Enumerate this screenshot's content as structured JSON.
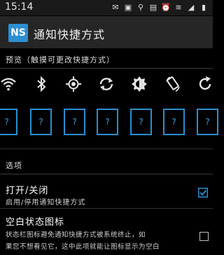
{
  "status_bar": {
    "time": "15:14"
  },
  "app_bar": {
    "logo_text": "NS",
    "title": "通知快捷方式"
  },
  "preview": {
    "header": "预览（触摸可更改快捷方式）",
    "icons": [
      "wifi-icon",
      "bluetooth-icon",
      "location-icon",
      "sync-icon",
      "brightness-icon",
      "rotate-icon",
      "refresh-icon"
    ],
    "placeholders": [
      "?",
      "?",
      "?",
      "?",
      "?",
      "?",
      "?"
    ]
  },
  "options": {
    "header": "选项",
    "items": [
      {
        "title": "打开/关闭",
        "desc": "启用/停用通知快捷方式",
        "checked": true
      },
      {
        "title": "空白状态图标",
        "desc_line1": "状态栏图标避免通知快捷方式被系统终止，如",
        "desc_line2": "果您不想看见它，这中此项就能让图标显示为空白",
        "checked": false
      }
    ]
  },
  "colors": {
    "accent": "#2b8fd0",
    "background": "#000000",
    "app_bar": "#262626"
  }
}
